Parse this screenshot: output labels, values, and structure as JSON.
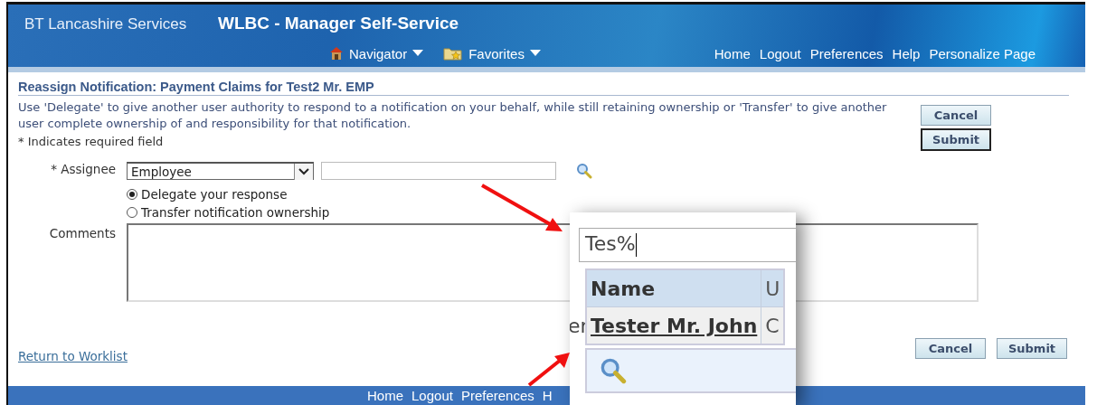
{
  "header": {
    "brand": "BT Lancashire Services",
    "app_title": "WLBC - Manager Self-Service",
    "menus": [
      {
        "label": "Navigator",
        "kind": "home"
      },
      {
        "label": "Favorites",
        "kind": "folder"
      }
    ],
    "global_links": [
      "Home",
      "Logout",
      "Preferences",
      "Help",
      "Personalize Page"
    ]
  },
  "page": {
    "title": "Reassign Notification: Payment Claims for Test2 Mr. EMP",
    "instructions": "Use 'Delegate' to give another user authority to respond to a notification on your behalf, while still retaining ownership or 'Transfer' to give another user complete ownership of and responsibility for that notification.",
    "required_note": "* Indicates required field",
    "top_buttons": [
      "Cancel",
      "Submit"
    ],
    "assignee": {
      "label": "* Assignee",
      "type_value": "Employee"
    },
    "options": [
      {
        "label": "Delegate your response",
        "selected": true
      },
      {
        "label": "Transfer notification ownership",
        "selected": false
      }
    ],
    "comments_label": "Comments",
    "return_link": "Return to Worklist",
    "bottom_buttons": [
      "Cancel",
      "Submit"
    ]
  },
  "lookup_popup": {
    "fragment": "er",
    "search_value": "Tes%",
    "columns": [
      "Name",
      "U"
    ],
    "rows": [
      [
        "Tester  Mr. John",
        "C"
      ]
    ]
  },
  "footer": {
    "links": [
      "Home",
      "Logout",
      "Preferences",
      "H"
    ]
  }
}
